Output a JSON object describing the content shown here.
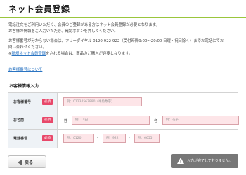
{
  "header": {
    "title": "ネット会員登録"
  },
  "intro": {
    "line1": "電話注文をご利用いただく、会員のご登録がある方はネット会員登録が必要となります。",
    "line2": "お客様の情報をご入力いただき、確認ボタンを押してください。",
    "line3": "お客様番号が分からない場合は、フリーダイヤル 0120-922-922（受付時間9:00〜20:00 日曜・祝日除く）までお電話にてお",
    "line4": "問い合わせください。",
    "line5_prefix": "※",
    "line5_link": "新規ネット会員登録",
    "line5_suffix": "をされる場合は、商品のご購入が必要となります。"
  },
  "help_link": "お客様番号について",
  "section": {
    "title": "お客様情報入力"
  },
  "form": {
    "customer_number": {
      "label": "お客様番号",
      "required": "必須",
      "placeholder": "例：01234567890（半角数字）"
    },
    "name": {
      "label": "お名前",
      "required": "必須",
      "last_label": "姓",
      "last_placeholder": "例：山田",
      "first_label": "名",
      "first_placeholder": "例：花子"
    },
    "phone": {
      "label": "電話番号",
      "required": "必須",
      "part1_placeholder": "例：0120",
      "part2_placeholder": "例：922",
      "part3_placeholder": "例：6655",
      "separator": "-"
    }
  },
  "footer": {
    "back_label": "戻る",
    "error_text": "入力が完了しておりません。"
  },
  "colors": {
    "accent_green": "#9ac63c",
    "required_badge": "#e8486a",
    "input_bg": "#fde5e8",
    "link": "#2a74c2"
  },
  "icons": {
    "back": "triangle-left-icon",
    "warning": "warning-icon"
  }
}
